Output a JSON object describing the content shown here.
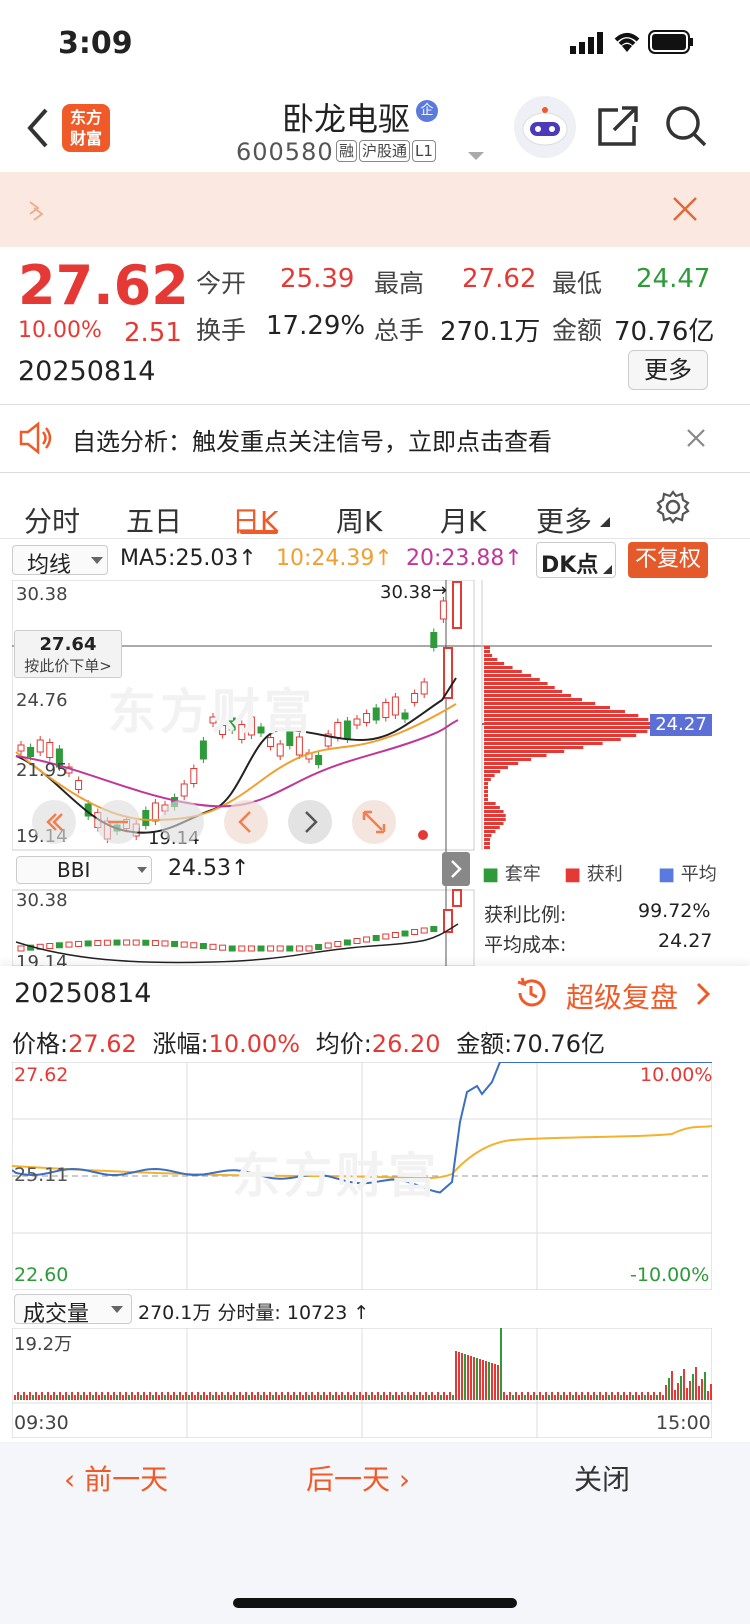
{
  "status_bar": {
    "time": "3:09"
  },
  "header": {
    "logo": "东方\n财富",
    "stock_name": "卧龙电驱",
    "badge": "企",
    "code": "600580",
    "tags": [
      "融",
      "沪股通",
      "L1"
    ]
  },
  "quote": {
    "price": "27.62",
    "change_pct": "10.00%",
    "change": "2.51",
    "date": "20250814",
    "open_label": "今开",
    "open": "25.39",
    "high_label": "最高",
    "high": "27.62",
    "low_label": "最低",
    "low": "24.47",
    "turnover_label": "换手",
    "turnover": "17.29%",
    "volume_label": "总手",
    "volume": "270.1万",
    "amount_label": "金额",
    "amount": "70.76亿",
    "more": "更多"
  },
  "alert": {
    "text": "自选分析：触发重点关注信号，立即点击查看"
  },
  "tabs": [
    "分时",
    "五日",
    "日K",
    "周K",
    "月K",
    "更多"
  ],
  "kline": {
    "indicator": "均线",
    "ma5": "MA5:25.03↑",
    "ma10": "10:24.39↑",
    "ma20": "20:23.88↑",
    "dk": "DK点",
    "fq": "不复权",
    "y_labels": [
      "30.38",
      "24.76",
      "21.95",
      "19.14"
    ],
    "top_mark": "30.38",
    "cross_price": "27.64",
    "cross_hint": "按此价下单>",
    "low_mark": "19.14",
    "watermark": "东方财富",
    "chip_avg": "24.27",
    "colors": {
      "up": "#e53935",
      "down": "#2e9a3a",
      "ma5": "#222222",
      "ma10": "#f0a030",
      "ma20": "#c0379a"
    }
  },
  "bbi": {
    "name": "BBI",
    "value": "24.53↑",
    "y_labels": [
      "30.38",
      "19.14"
    ]
  },
  "chips": {
    "legend": [
      "套牢",
      "获利",
      "平均"
    ],
    "profit_ratio_label": "获利比例:",
    "profit_ratio": "99.72%",
    "avg_cost_label": "平均成本:",
    "avg_cost": "24.27"
  },
  "review": {
    "date": "20250814",
    "link": "超级复盘",
    "price_label": "价格:",
    "price": "27.62",
    "pct_label": "涨幅:",
    "pct": "10.00%",
    "avg_label": "均价:",
    "avg": "26.20",
    "amount_label": "金额:",
    "amount": "70.76亿",
    "y_top": "27.62",
    "y_mid": "25.11",
    "y_bot": "22.60",
    "pct_top": "10.00%",
    "pct_bot": "-10.00%",
    "vol_indicator": "成交量",
    "vol_text": "270.1万 分时量: 10723 ↑",
    "vol_max": "19.2万",
    "t_start": "09:30",
    "t_end": "15:00"
  },
  "footer": {
    "prev": "前一天",
    "next": "后一天",
    "close": "关闭"
  }
}
